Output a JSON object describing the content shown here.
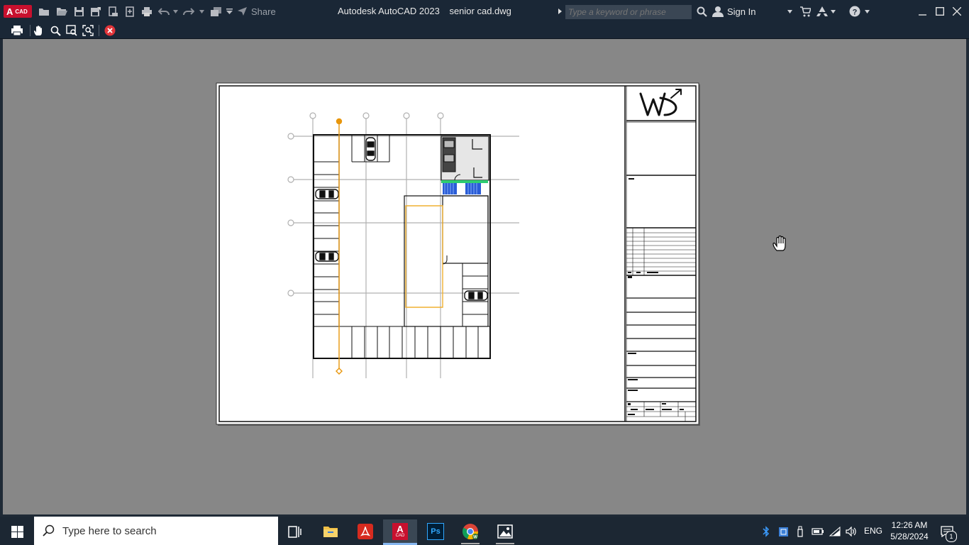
{
  "app": {
    "logo_letter": "A",
    "logo_sub": "CAD",
    "title": "Autodesk AutoCAD 2023",
    "filename": "senior cad.dwg",
    "share_label": "Share",
    "search_placeholder": "Type a keyword or phrase",
    "sign_in_label": "Sign In"
  },
  "colors": {
    "accent": "#c8102e",
    "highlight": "#e8960c",
    "grid_lines": "#b0b0b0",
    "close_circle": "#e2353a"
  },
  "taskbar": {
    "search_placeholder": "Type here to search",
    "language": "ENG",
    "time": "12:26 AM",
    "date": "5/28/2024",
    "notification_count": "1",
    "ps_label": "Ps"
  }
}
